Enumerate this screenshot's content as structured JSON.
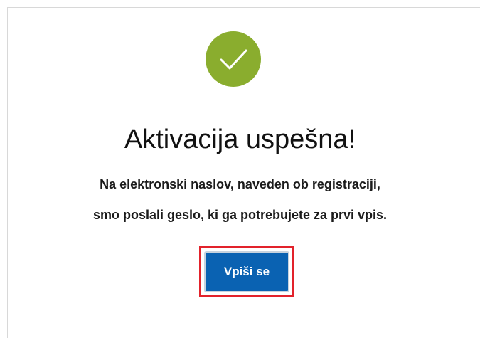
{
  "success_icon": {
    "icon": "checkmark-icon",
    "color": "#8aad2e"
  },
  "title": "Aktivacija uspešna!",
  "message": {
    "line1": "Na elektronski naslov, naveden ob registraciji,",
    "line2": "smo poslali geslo, ki ga potrebujete za prvi vpis."
  },
  "login_button": {
    "label": "Vpiši se",
    "color": "#0a62b2"
  },
  "highlight": {
    "color": "#e2222b"
  }
}
